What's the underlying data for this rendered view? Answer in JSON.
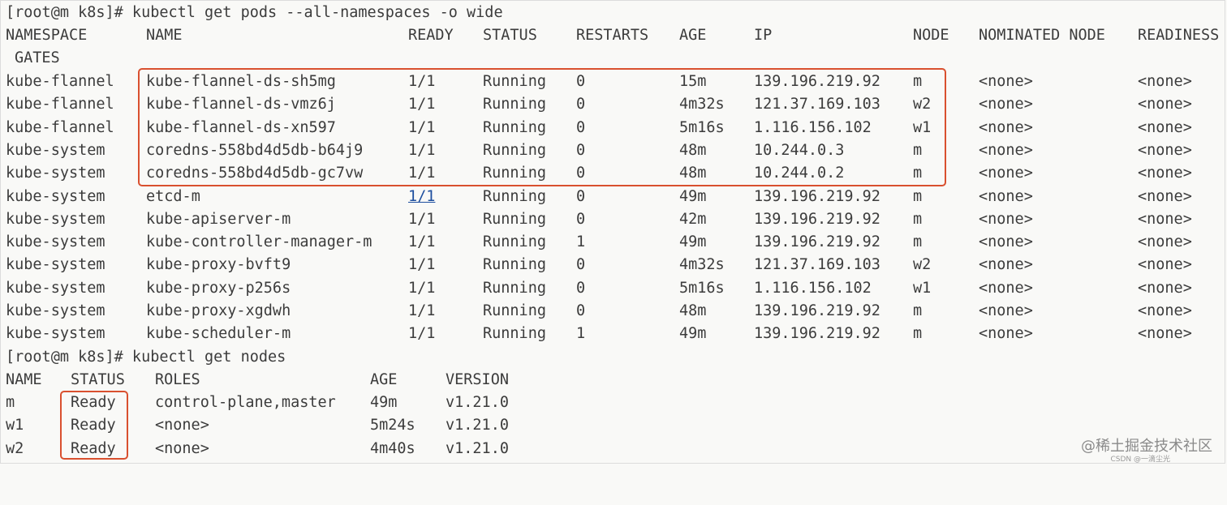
{
  "terminal": {
    "cmd1": "[root@m k8s]# kubectl get pods --all-namespaces -o wide",
    "pods_headers": [
      "NAMESPACE",
      "NAME",
      "READY",
      "STATUS",
      "RESTARTS",
      "AGE",
      "IP",
      "NODE",
      "NOMINATED NODE",
      "READINESS"
    ],
    "pods_header_wrap": "GATES",
    "pods": [
      [
        "kube-flannel",
        "kube-flannel-ds-sh5mg",
        "1/1",
        "Running",
        "0",
        "15m",
        "139.196.219.92",
        "m",
        "<none>",
        "<none>"
      ],
      [
        "kube-flannel",
        "kube-flannel-ds-vmz6j",
        "1/1",
        "Running",
        "0",
        "4m32s",
        "121.37.169.103",
        "w2",
        "<none>",
        "<none>"
      ],
      [
        "kube-flannel",
        "kube-flannel-ds-xn597",
        "1/1",
        "Running",
        "0",
        "5m16s",
        "1.116.156.102",
        "w1",
        "<none>",
        "<none>"
      ],
      [
        "kube-system",
        "coredns-558bd4d5db-b64j9",
        "1/1",
        "Running",
        "0",
        "48m",
        "10.244.0.3",
        "m",
        "<none>",
        "<none>"
      ],
      [
        "kube-system",
        "coredns-558bd4d5db-gc7vw",
        "1/1",
        "Running",
        "0",
        "48m",
        "10.244.0.2",
        "m",
        "<none>",
        "<none>"
      ],
      [
        "kube-system",
        "etcd-m",
        "1/1",
        "Running",
        "0",
        "49m",
        "139.196.219.92",
        "m",
        "<none>",
        "<none>"
      ],
      [
        "kube-system",
        "kube-apiserver-m",
        "1/1",
        "Running",
        "0",
        "42m",
        "139.196.219.92",
        "m",
        "<none>",
        "<none>"
      ],
      [
        "kube-system",
        "kube-controller-manager-m",
        "1/1",
        "Running",
        "1",
        "49m",
        "139.196.219.92",
        "m",
        "<none>",
        "<none>"
      ],
      [
        "kube-system",
        "kube-proxy-bvft9",
        "1/1",
        "Running",
        "0",
        "4m32s",
        "121.37.169.103",
        "w2",
        "<none>",
        "<none>"
      ],
      [
        "kube-system",
        "kube-proxy-p256s",
        "1/1",
        "Running",
        "0",
        "5m16s",
        "1.116.156.102",
        "w1",
        "<none>",
        "<none>"
      ],
      [
        "kube-system",
        "kube-proxy-xgdwh",
        "1/1",
        "Running",
        "0",
        "48m",
        "139.196.219.92",
        "m",
        "<none>",
        "<none>"
      ],
      [
        "kube-system",
        "kube-scheduler-m",
        "1/1",
        "Running",
        "1",
        "49m",
        "139.196.219.92",
        "m",
        "<none>",
        "<none>"
      ]
    ],
    "cmd2": "[root@m k8s]# kubectl get nodes",
    "nodes_headers": [
      "NAME",
      "STATUS",
      "ROLES",
      "AGE",
      "VERSION"
    ],
    "nodes": [
      [
        "m",
        "Ready",
        "control-plane,master",
        "49m",
        "v1.21.0"
      ],
      [
        "w1",
        "Ready",
        "<none>",
        "5m24s",
        "v1.21.0"
      ],
      [
        "w2",
        "Ready",
        "<none>",
        "4m40s",
        "v1.21.0"
      ]
    ]
  },
  "watermark": "@稀土掘金技术社区",
  "watermark_small": "CSDN @一滴尘光",
  "colors": {
    "highlight": "#d9502f",
    "link": "#1d4e9e",
    "background": "#f9f9f7"
  }
}
